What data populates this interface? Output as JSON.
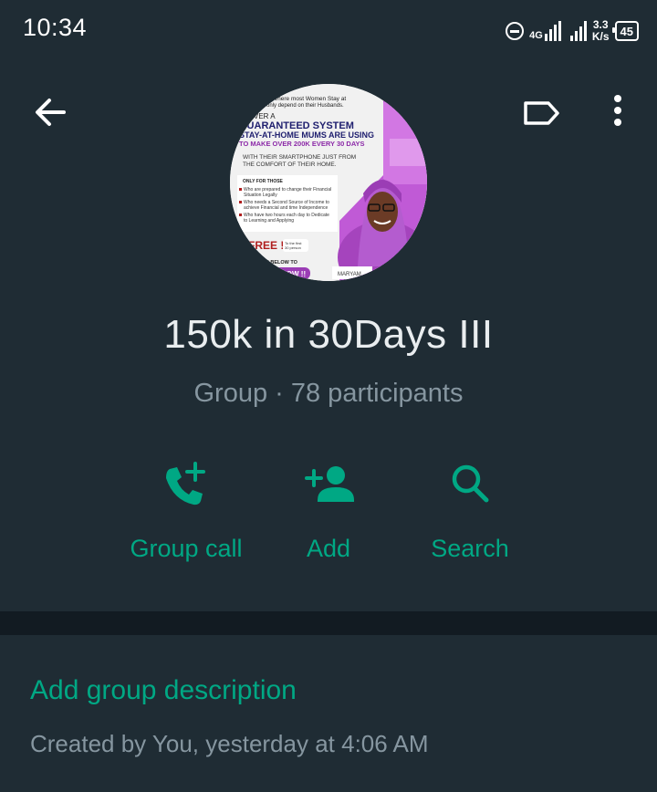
{
  "status_bar": {
    "time": "10:34",
    "network": "4G",
    "speed_value": "3.3",
    "speed_unit": "K/s",
    "battery": "45",
    "icons": [
      "do-not-disturb-icon",
      "signal-icon",
      "signal-icon",
      "battery-icon"
    ]
  },
  "toolbar": {
    "back_icon": "arrow-back-icon",
    "label_icon": "label-icon",
    "more_icon": "more-vert-icon"
  },
  "group": {
    "name": "150k in 30Days III",
    "subtitle": "Group · 78 participants"
  },
  "avatar_flyer": {
    "line1": "Where most Women Stay at",
    "line2": "only depend on their Husbands.",
    "line3": "COVER A",
    "line4": "GUARANTEED SYSTEM",
    "line5": "STAY-AT-HOME MUMS ARE USING",
    "line6": "TO MAKE OVER 200K EVERY 30 DAYS",
    "line7": "WITH THEIR SMARTPHONE JUST FROM",
    "line8": "THE COMFORT OF THEIR HOME.",
    "only_for": "ONLY FOR THOSE",
    "bullet1a": "Who are prepared to change their Financial",
    "bullet1b": "Situation Legally",
    "bullet2a": "Who needs a Second Source of Income to",
    "bullet2b": "achieve Financial and time Independence",
    "bullet3a": "Who have two hours each day to Dedicate",
    "bullet3b": "to Learning and Applying",
    "free": "FREE !!",
    "free_note1": "To the first",
    "free_note2": "30 person",
    "link": "LINK BELOW TO",
    "now": "NOW !!",
    "name": "MARYAM"
  },
  "actions": [
    {
      "label": "Group call",
      "icon": "add-call-icon"
    },
    {
      "label": "Add",
      "icon": "add-person-icon"
    },
    {
      "label": "Search",
      "icon": "search-icon"
    }
  ],
  "description": {
    "link": "Add group description",
    "created": "Created by You, yesterday at 4:06 AM"
  },
  "colors": {
    "background": "#121b22",
    "panel": "#1f2c34",
    "accent": "#00a884",
    "primary_text": "#e9edef",
    "secondary_text": "#8696a0"
  }
}
